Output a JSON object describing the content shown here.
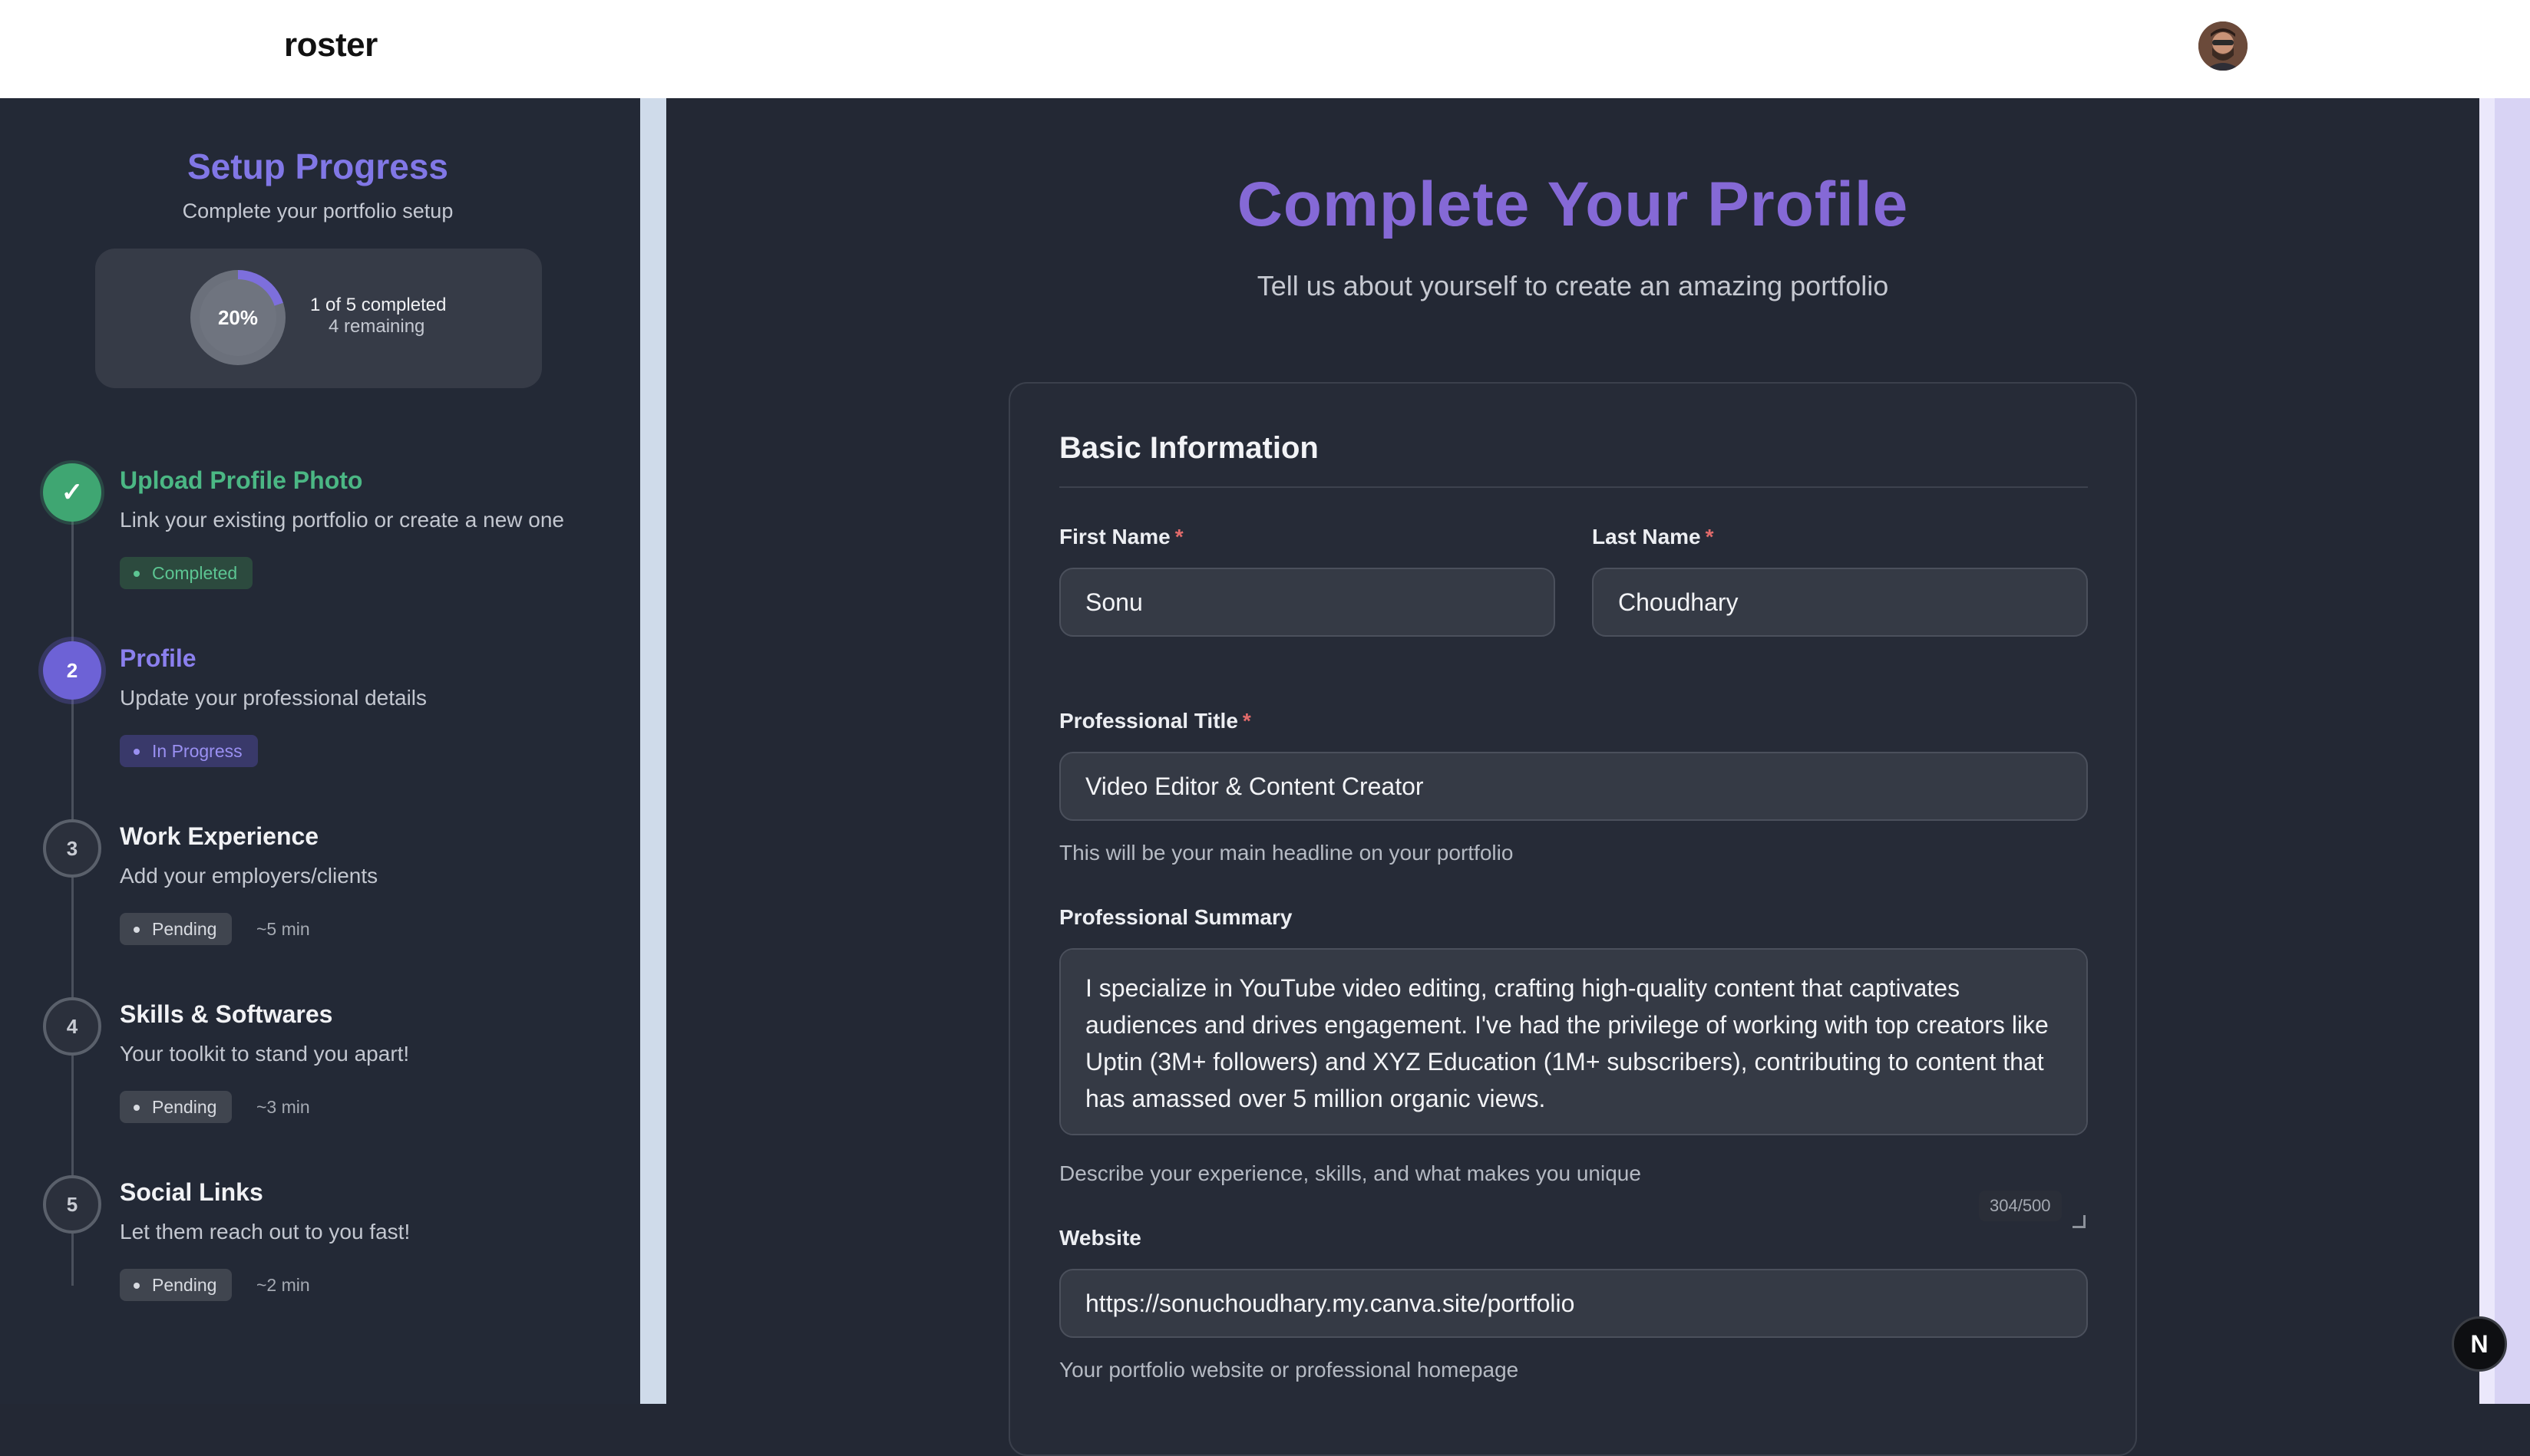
{
  "app": {
    "logo": "roster"
  },
  "sidebar": {
    "title": "Setup Progress",
    "subtitle": "Complete your portfolio setup",
    "progress": {
      "percent_label": "20%",
      "percent": 20,
      "completed_text": "1 of 5 completed",
      "remaining_text": "4 remaining"
    },
    "steps": [
      {
        "marker": "✓",
        "title": "Upload Profile Photo",
        "description": "Link your existing portfolio or create a new one",
        "status": "Completed",
        "eta": ""
      },
      {
        "marker": "2",
        "title": "Profile",
        "description": "Update your professional details",
        "status": "In Progress",
        "eta": ""
      },
      {
        "marker": "3",
        "title": "Work Experience",
        "description": "Add your employers/clients",
        "status": "Pending",
        "eta": "~5 min"
      },
      {
        "marker": "4",
        "title": "Skills & Softwares",
        "description": "Your toolkit to stand you apart!",
        "status": "Pending",
        "eta": "~3 min"
      },
      {
        "marker": "5",
        "title": "Social Links",
        "description": "Let them reach out to you fast!",
        "status": "Pending",
        "eta": "~2 min"
      }
    ]
  },
  "main": {
    "title": "Complete Your Profile",
    "subtitle": "Tell us about yourself to create an amazing portfolio",
    "section_title": "Basic Information",
    "required_mark": "*",
    "first_name": {
      "label": "First Name",
      "value": "Sonu"
    },
    "last_name": {
      "label": "Last Name",
      "value": "Choudhary"
    },
    "professional_title": {
      "label": "Professional Title",
      "value": "Video Editor & Content Creator",
      "help": "This will be your main headline on your portfolio"
    },
    "professional_summary": {
      "label": "Professional Summary",
      "value": "I specialize in YouTube video editing, crafting high-quality content that captivates audiences and drives engagement. I've had the privilege of working with top creators like Uptin (3M+ followers) and XYZ Education (1M+ subscribers), contributing to content that has amassed over 5 million organic views.",
      "counter": "304/500",
      "help": "Describe your experience, skills, and what makes you unique"
    },
    "website": {
      "label": "Website",
      "value": "https://sonuchoudhary.my.canva.site/portfolio",
      "help": "Your portfolio website or professional homepage"
    }
  },
  "floating_button": {
    "label": "N"
  },
  "colors": {
    "accent": "#8177e6",
    "success": "#4bb784",
    "background": "#232834",
    "required": "#e26b6b"
  }
}
